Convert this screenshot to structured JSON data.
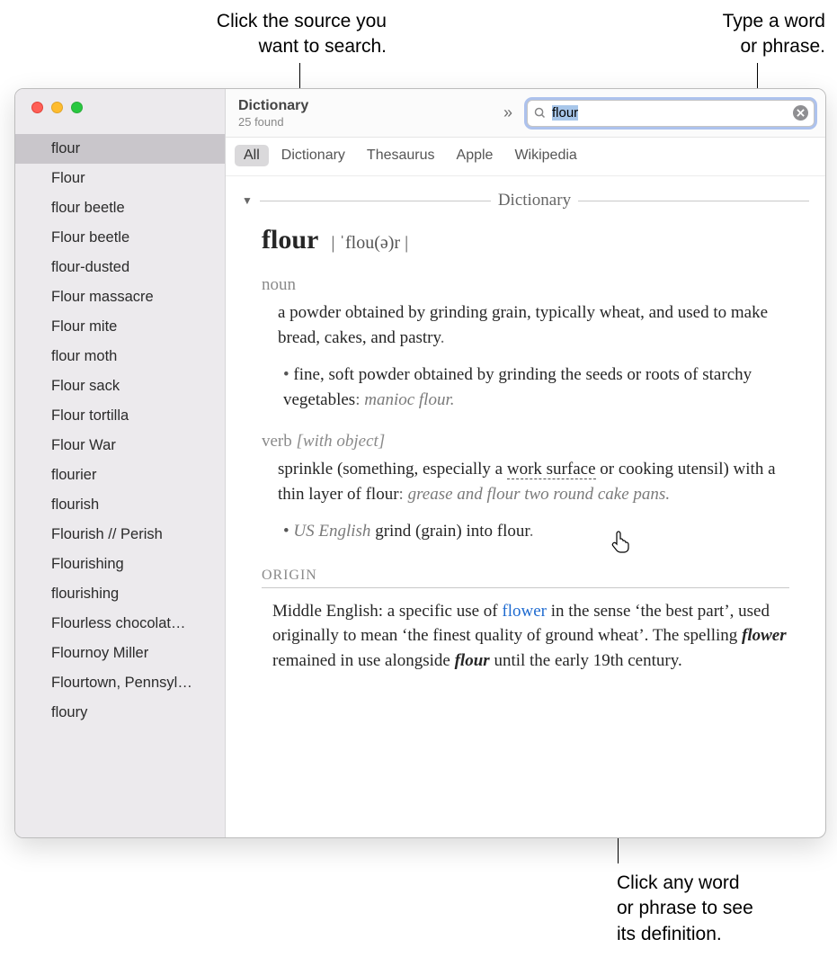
{
  "callouts": {
    "source": "Click the source you\nwant to search.",
    "search": "Type a word\nor phrase.",
    "lookup": "Click any word\nor phrase to see\nits definition."
  },
  "toolbar": {
    "title": "Dictionary",
    "subtitle": "25 found",
    "search_value": "flour"
  },
  "tabs": [
    "All",
    "Dictionary",
    "Thesaurus",
    "Apple",
    "Wikipedia"
  ],
  "section_title": "Dictionary",
  "sidebar": {
    "items": [
      "flour",
      "Flour",
      "flour beetle",
      "Flour beetle",
      "flour-dusted",
      "Flour massacre",
      "Flour mite",
      "flour moth",
      "Flour sack",
      "Flour tortilla",
      "Flour War",
      "flourier",
      "flourish",
      "Flourish // Perish",
      "Flourishing",
      "flourishing",
      "Flourless chocolat…",
      "Flournoy Miller",
      "Flourtown, Pennsyl…",
      "floury"
    ]
  },
  "entry": {
    "headword": "flour",
    "pron": "| ˈflou(ə)r |",
    "noun": {
      "label": "noun",
      "def": "a powder obtained by grinding grain, typically wheat, and used to make bread, cakes, and pastry",
      "sub_pre": "fine, soft powder obtained by grinding the seeds or roots of starchy vegetables",
      "sub_ex": "manioc flour."
    },
    "verb": {
      "label": "verb",
      "extra": "[with object]",
      "def_pre": "sprinkle (something, especially a ",
      "def_link": "work surface",
      "def_post": " or cooking utensil) with a thin layer of flour",
      "ex": "grease and flour two round cake pans.",
      "sub_region": "US English",
      "sub_text": "grind (grain) into flour"
    },
    "origin": {
      "label": "ORIGIN",
      "t1": "Middle English: a specific use of ",
      "link": "flower",
      "t2": " in the sense ‘the best part’, used originally to mean ‘the finest quality of ground wheat’. The spelling ",
      "b1": "flower",
      "t3": " remained in use alongside ",
      "b2": "flour",
      "t4": " until the early 19th century."
    }
  }
}
